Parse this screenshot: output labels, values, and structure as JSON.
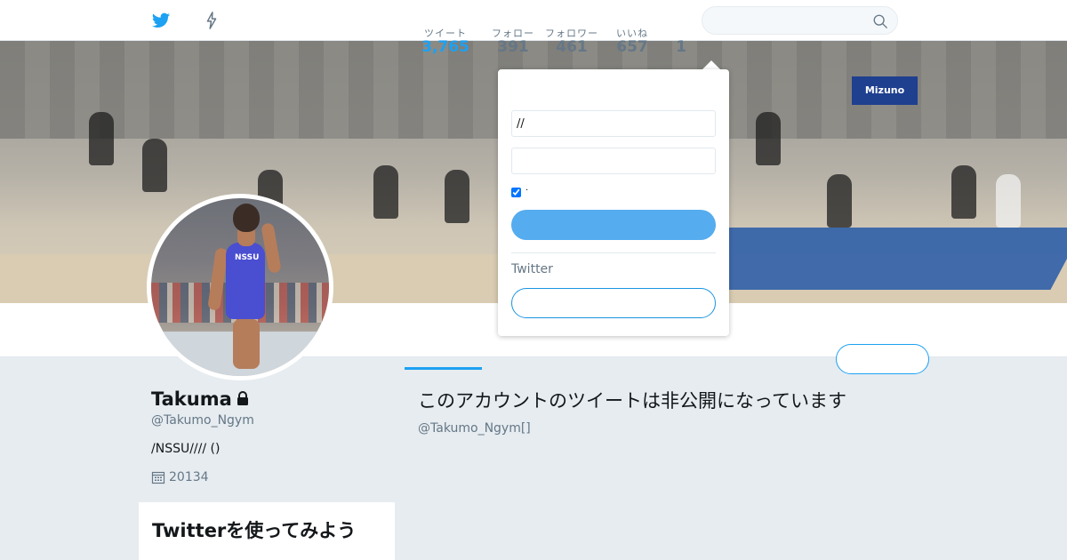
{
  "topbar": {
    "search_placeholder": ""
  },
  "banner": {
    "sign_text": "Mizuno"
  },
  "avatar": {
    "shirt_text": "NSSU"
  },
  "profile": {
    "name": "Takuma",
    "handle": "@Takumo_Ngym",
    "bio": "/NSSU//// ()",
    "joined": "20134"
  },
  "stats": [
    {
      "label": "ツイート",
      "value": "3,765",
      "active": true
    },
    {
      "label": "フォロー",
      "value": "391",
      "active": false
    },
    {
      "label": "フォロワー",
      "value": "461",
      "active": false
    },
    {
      "label": "いいね",
      "value": "657",
      "active": false
    },
    {
      "label": "",
      "value": "1",
      "active": false
    }
  ],
  "protected": {
    "heading": "このアカウントのツイートは非公開になっています",
    "subtext": "@Takumo_Ngym[]"
  },
  "side_card": {
    "title": "Twitterを使ってみよう"
  },
  "login": {
    "username_value": "//",
    "password_value": "",
    "remember_label": "·",
    "remember_checked": true,
    "signup_prompt": "Twitter"
  },
  "colors": {
    "accent": "#1da1f2",
    "login_button": "#55acee",
    "page_bg": "#e6ecf0"
  }
}
